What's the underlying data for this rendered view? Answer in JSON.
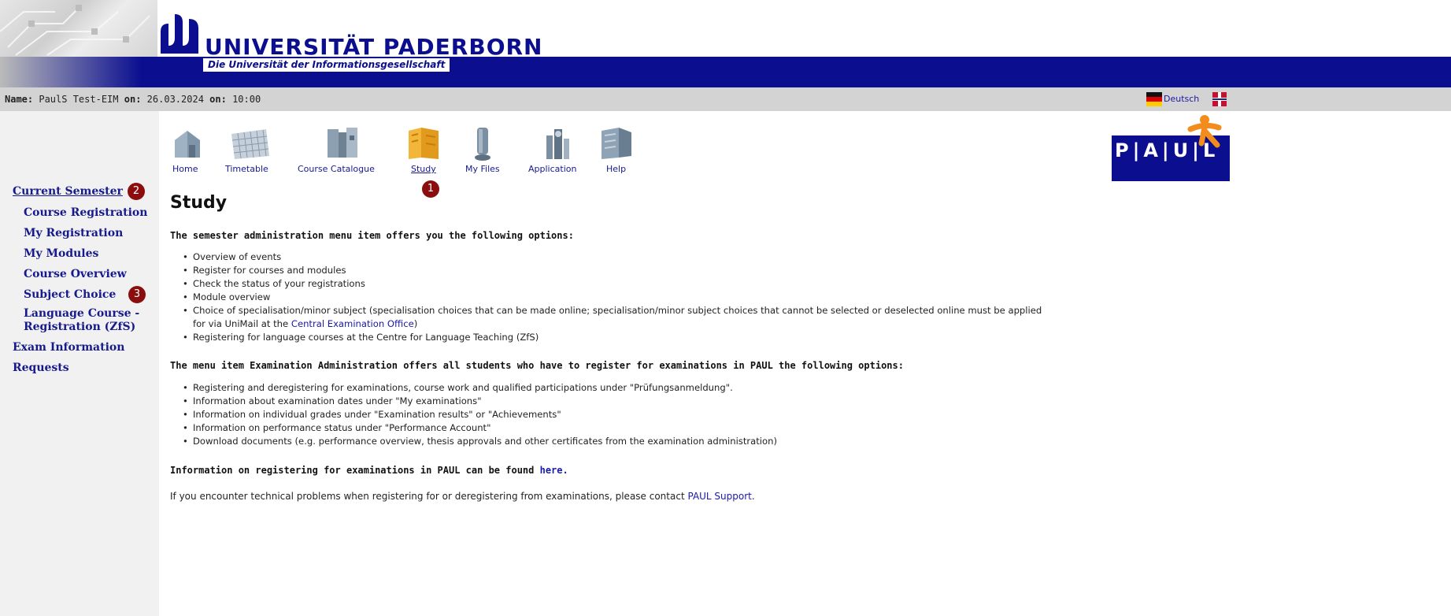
{
  "header": {
    "university_name": "UNIVERSITÄT PADERBORN",
    "university_subtitle": "Die Universität der Informationsgesellschaft"
  },
  "info_bar": {
    "name_label": "Name:",
    "name_value": "PaulS Test-EIM",
    "date_label": "on:",
    "date_value": "26.03.2024",
    "time_label": "on:",
    "time_value": "10:00",
    "language_link": "Deutsch"
  },
  "nav": {
    "items": [
      {
        "label": "Home",
        "icon": "home-icon"
      },
      {
        "label": "Timetable",
        "icon": "timetable-icon"
      },
      {
        "label": "Course Catalogue",
        "icon": "course-catalogue-icon"
      },
      {
        "label": "Study",
        "icon": "study-icon"
      },
      {
        "label": "My Files",
        "icon": "my-files-icon"
      },
      {
        "label": "Application",
        "icon": "application-icon"
      },
      {
        "label": "Help",
        "icon": "help-icon"
      }
    ],
    "active": "Study"
  },
  "paul_logo": {
    "text": "P|A|U|L"
  },
  "sidebar": {
    "items": [
      {
        "label": "Current Semester"
      },
      {
        "label": "Course Registration"
      },
      {
        "label": "My Registration"
      },
      {
        "label": "My Modules"
      },
      {
        "label": "Course Overview"
      },
      {
        "label": "Subject Choice"
      },
      {
        "label": "Language Course -"
      },
      {
        "label": "Registration (ZfS)"
      },
      {
        "label": "Exam Information"
      },
      {
        "label": "Requests"
      }
    ]
  },
  "badges": [
    "1",
    "2",
    "3"
  ],
  "main": {
    "title": "Study",
    "semester_intro": "The semester administration menu item offers you the following options:",
    "semester_options": [
      "Overview of events",
      "Register for courses and modules",
      "Check the status of your registrations",
      "Module overview",
      "Choice of specialisation/minor subject (specialisation choices that can be made online; specialisation/minor subject choices that cannot be selected or deselected online must be applied",
      "Registering for language courses at the Centre for Language Teaching (ZfS)"
    ],
    "specialisation_cont_prefix": "for via UniMail at the ",
    "central_exam_office_link": "Central Examination Office",
    "specialisation_cont_suffix": ")",
    "exam_intro": "The menu item Examination Administration offers all students who have to register for examinations in PAUL the following options:",
    "exam_options": [
      "Registering and deregistering for examinations, course work and qualified participations under \"Prüfungsanmeldung\".",
      "Information about examination dates under \"My examinations\"",
      "Information on individual grades under \"Examination results\" or \"Achievements\"",
      "Information on performance status under \"Performance Account\"",
      "Download documents (e.g. performance overview, thesis approvals and other certificates from the examination administration)"
    ],
    "registering_info_prefix": "Information on registering for examinations in PAUL can be found ",
    "registering_info_link": "here.",
    "support_prefix": "If you encounter technical problems when registering for or deregistering from examinations, please contact ",
    "support_link": "PAUL Support",
    "support_suffix": "."
  }
}
